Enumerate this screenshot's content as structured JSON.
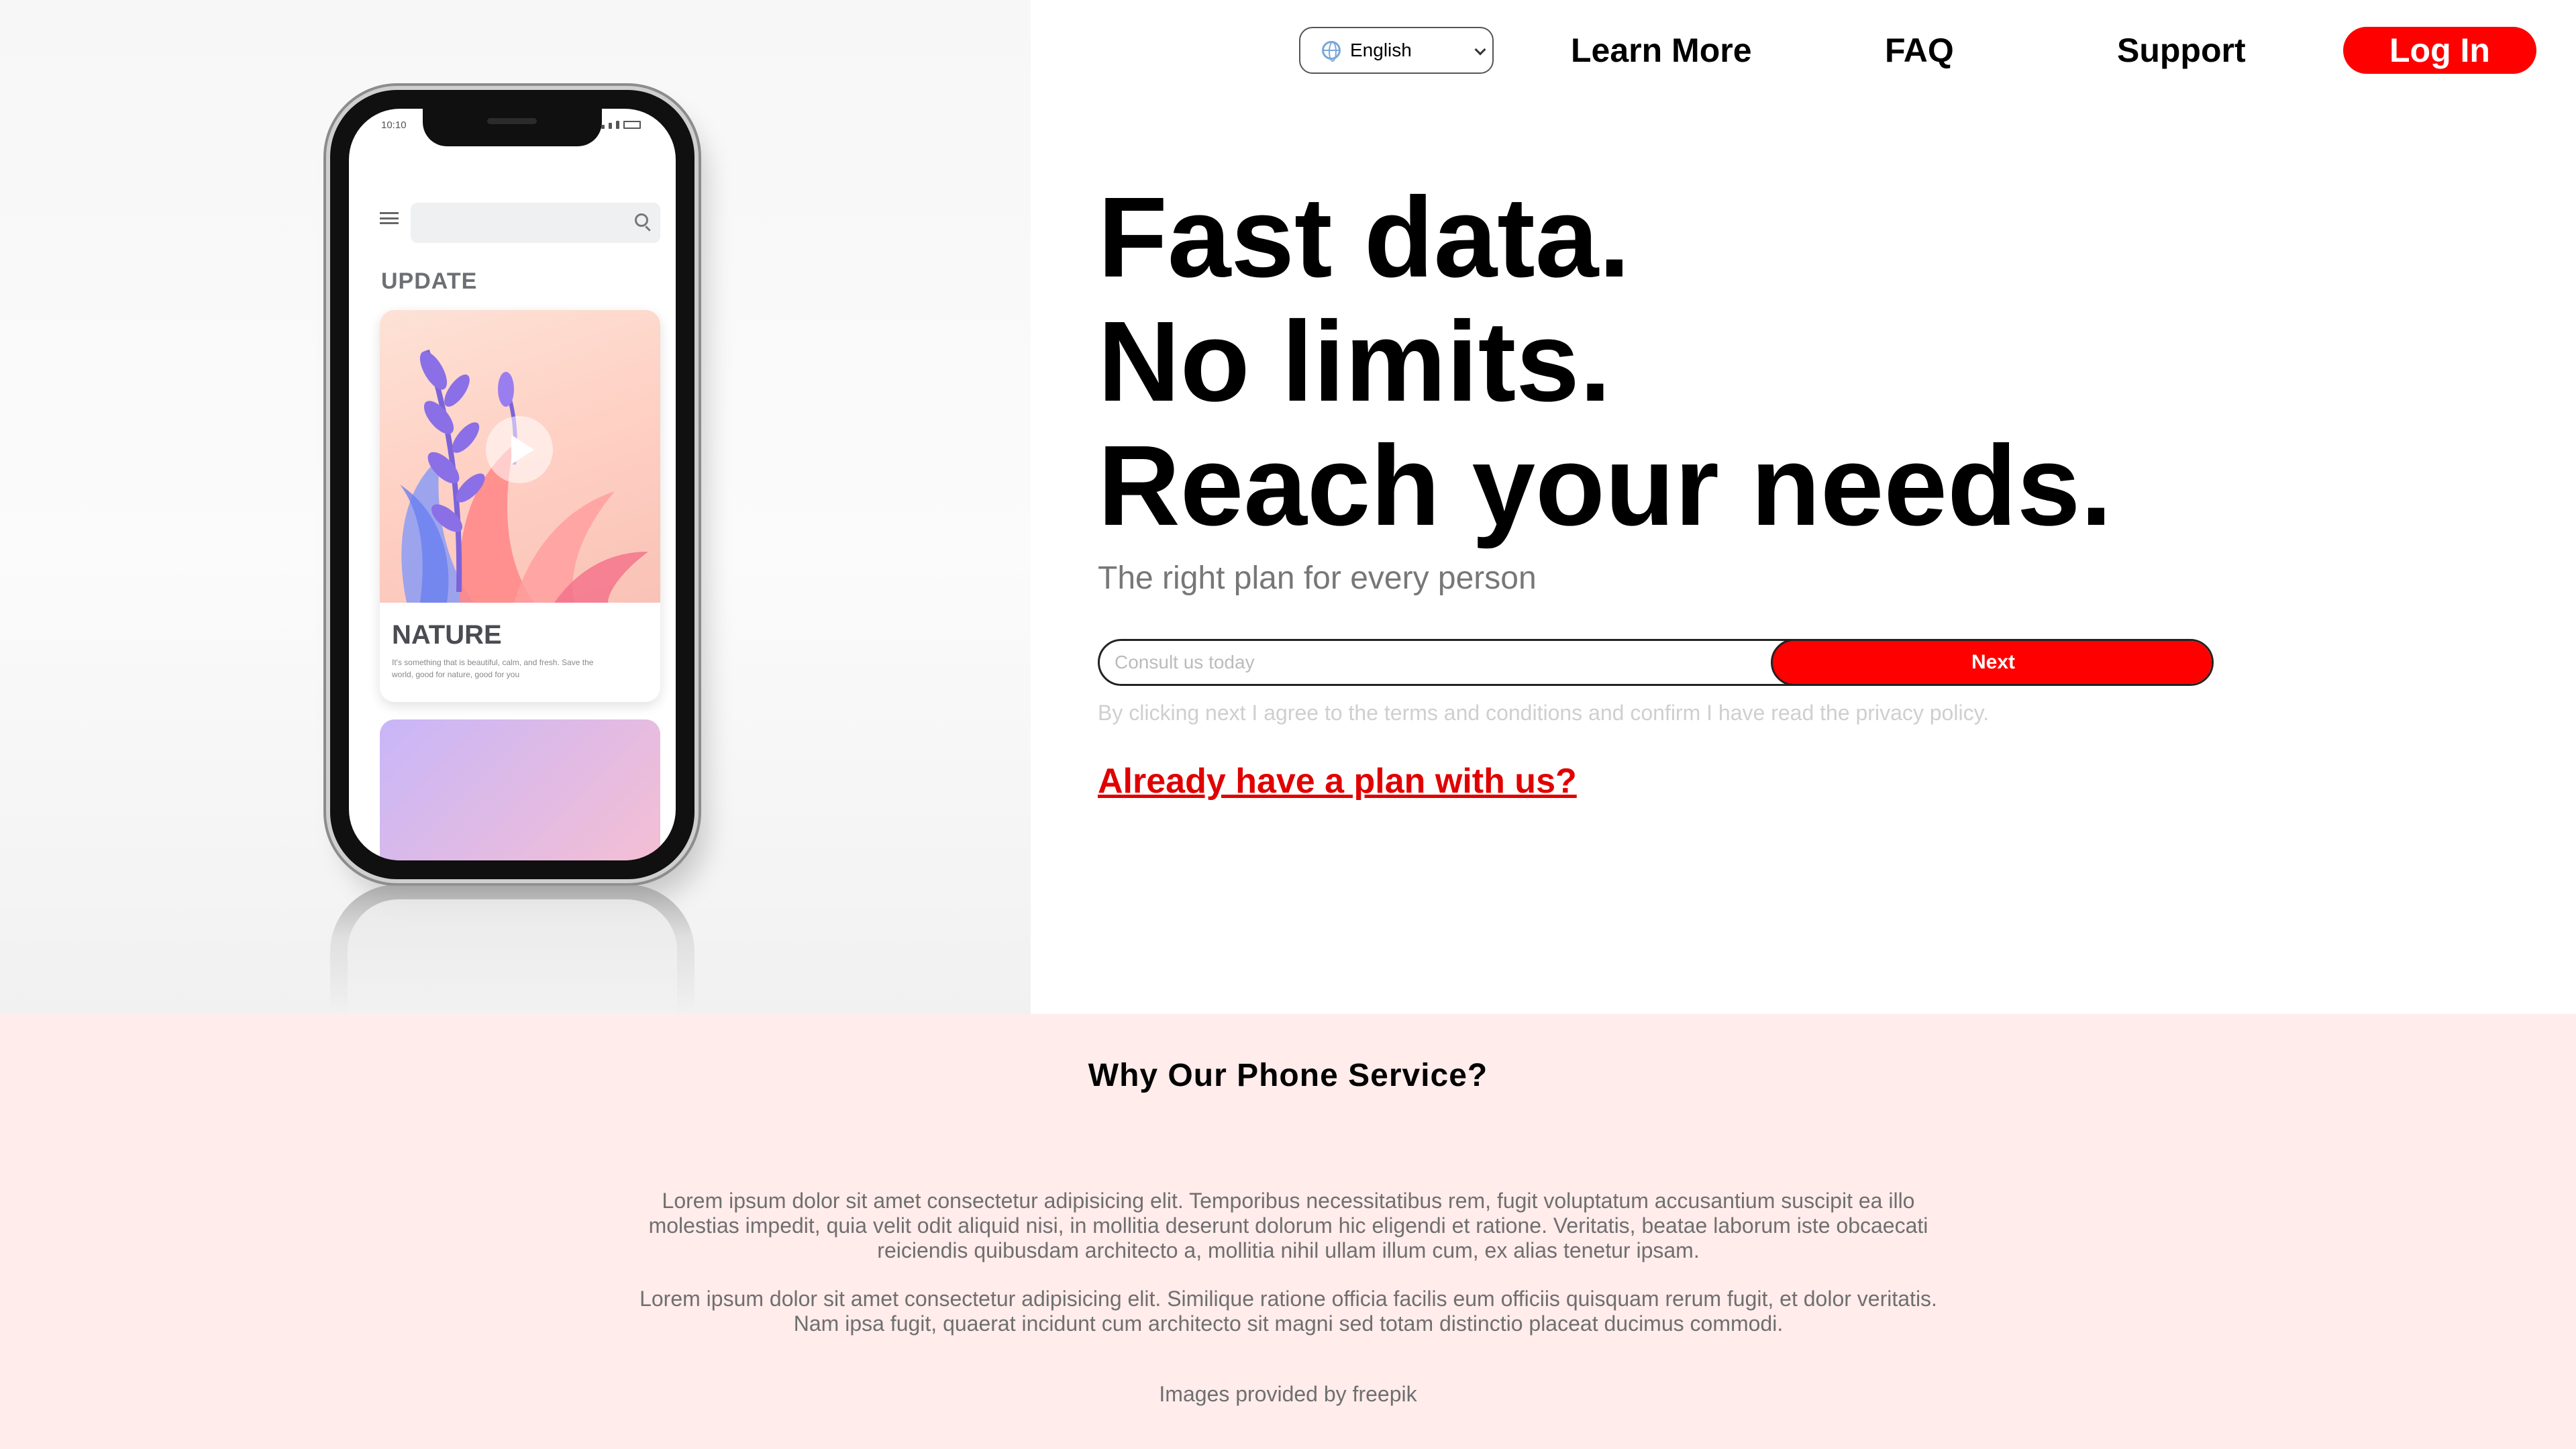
{
  "header": {
    "language_selected": "English",
    "nav": [
      "Learn More",
      "FAQ",
      "Support"
    ],
    "login_label": "Log In"
  },
  "phone_mockup": {
    "time": "10:10",
    "section_label": "UPDATE",
    "card_title": "NATURE",
    "card_text": "It's something that is beautiful, calm, and fresh. Save the world, good for nature, good for you"
  },
  "hero": {
    "headline": [
      "Fast data.",
      "No limits.",
      "Reach your needs."
    ],
    "subheadline": "The right plan for every person",
    "input_placeholder": "Consult us today",
    "next_label": "Next",
    "terms": "By clicking next I agree to the terms and conditions and confirm I have read the privacy policy.",
    "existing_plan_link": "Already have a plan with us?"
  },
  "why_section": {
    "title": "Why Our Phone Service?",
    "paragraphs": [
      "Lorem ipsum dolor sit amet consectetur adipisicing elit. Temporibus necessitatibus rem, fugit voluptatum accusantium suscipit ea illo molestias impedit, quia velit odit aliquid nisi, in mollitia deserunt dolorum hic eligendi et ratione. Veritatis, beatae laborum iste obcaecati reiciendis quibusdam architecto a, mollitia nihil ullam illum cum, ex alias tenetur ipsam.",
      "Lorem ipsum dolor sit amet consectetur adipisicing elit. Similique ratione officia facilis eum officiis quisquam rerum fugit, et dolor veritatis. Nam ipsa fugit, quaerat incidunt cum architecto sit magni sed totam distinctio placeat ducimus commodi."
    ],
    "credit": "Images provided by freepik"
  },
  "colors": {
    "accent": "#ff0000",
    "section_bg": "#ffeceb"
  }
}
